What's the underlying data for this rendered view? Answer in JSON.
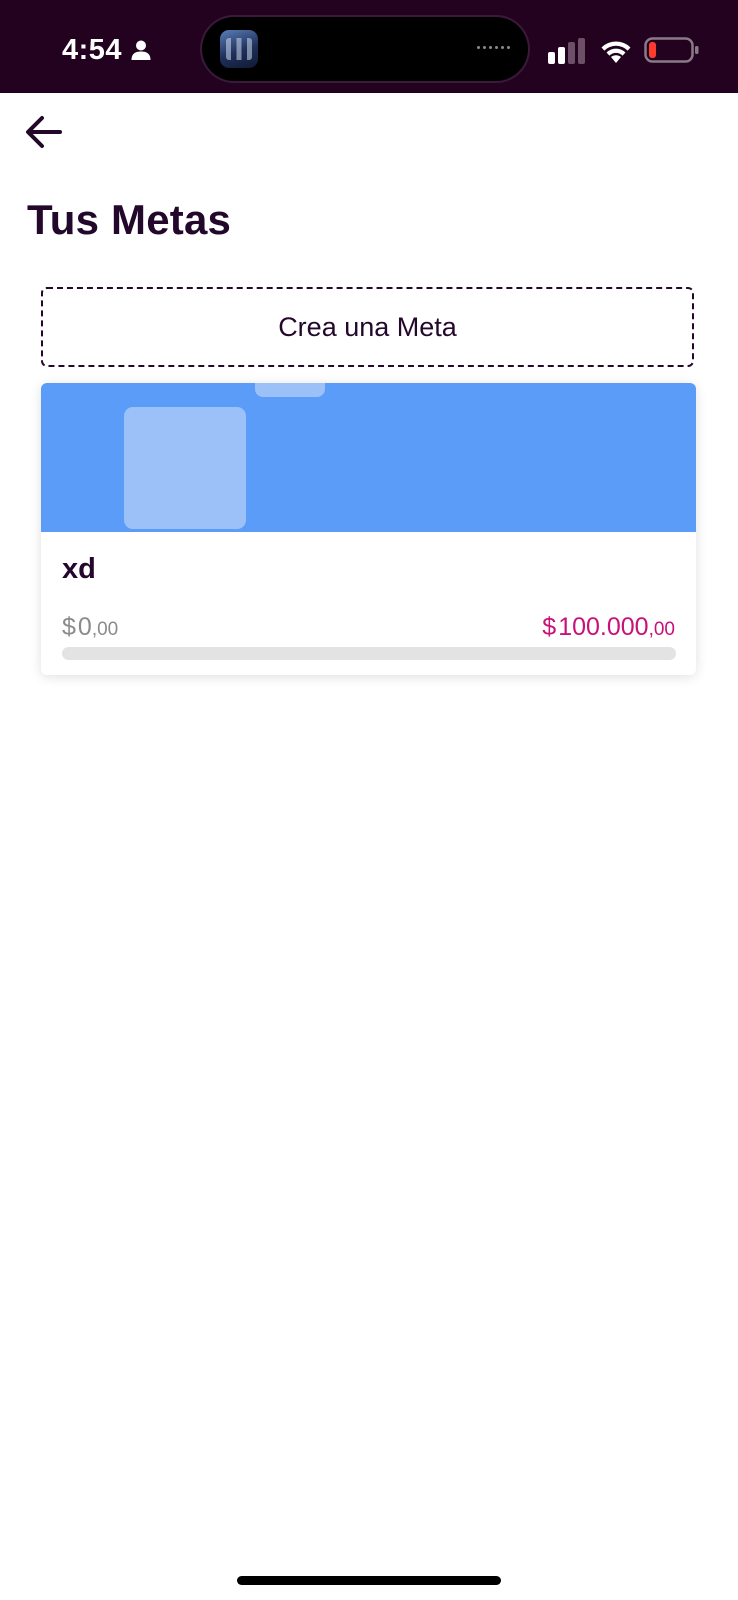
{
  "status_bar": {
    "time": "4:54",
    "background": "#23021f",
    "icons": [
      "person-icon",
      "cellular-signal-icon",
      "wifi-icon",
      "battery-low-icon"
    ],
    "battery_color": "#ff3b30"
  },
  "header": {
    "back_icon": "arrow-left-icon",
    "title": "Tus Metas"
  },
  "create_goal": {
    "label": "Crea una Meta"
  },
  "goals": [
    {
      "name": "xd",
      "banner_color": "#5a9cf8",
      "saved": {
        "currency": "$",
        "integer": "0",
        "decimals": ",00"
      },
      "target": {
        "currency": "$",
        "integer": "100.000",
        "decimals": ",00"
      },
      "progress": 0,
      "target_color": "#c8127a"
    }
  ]
}
